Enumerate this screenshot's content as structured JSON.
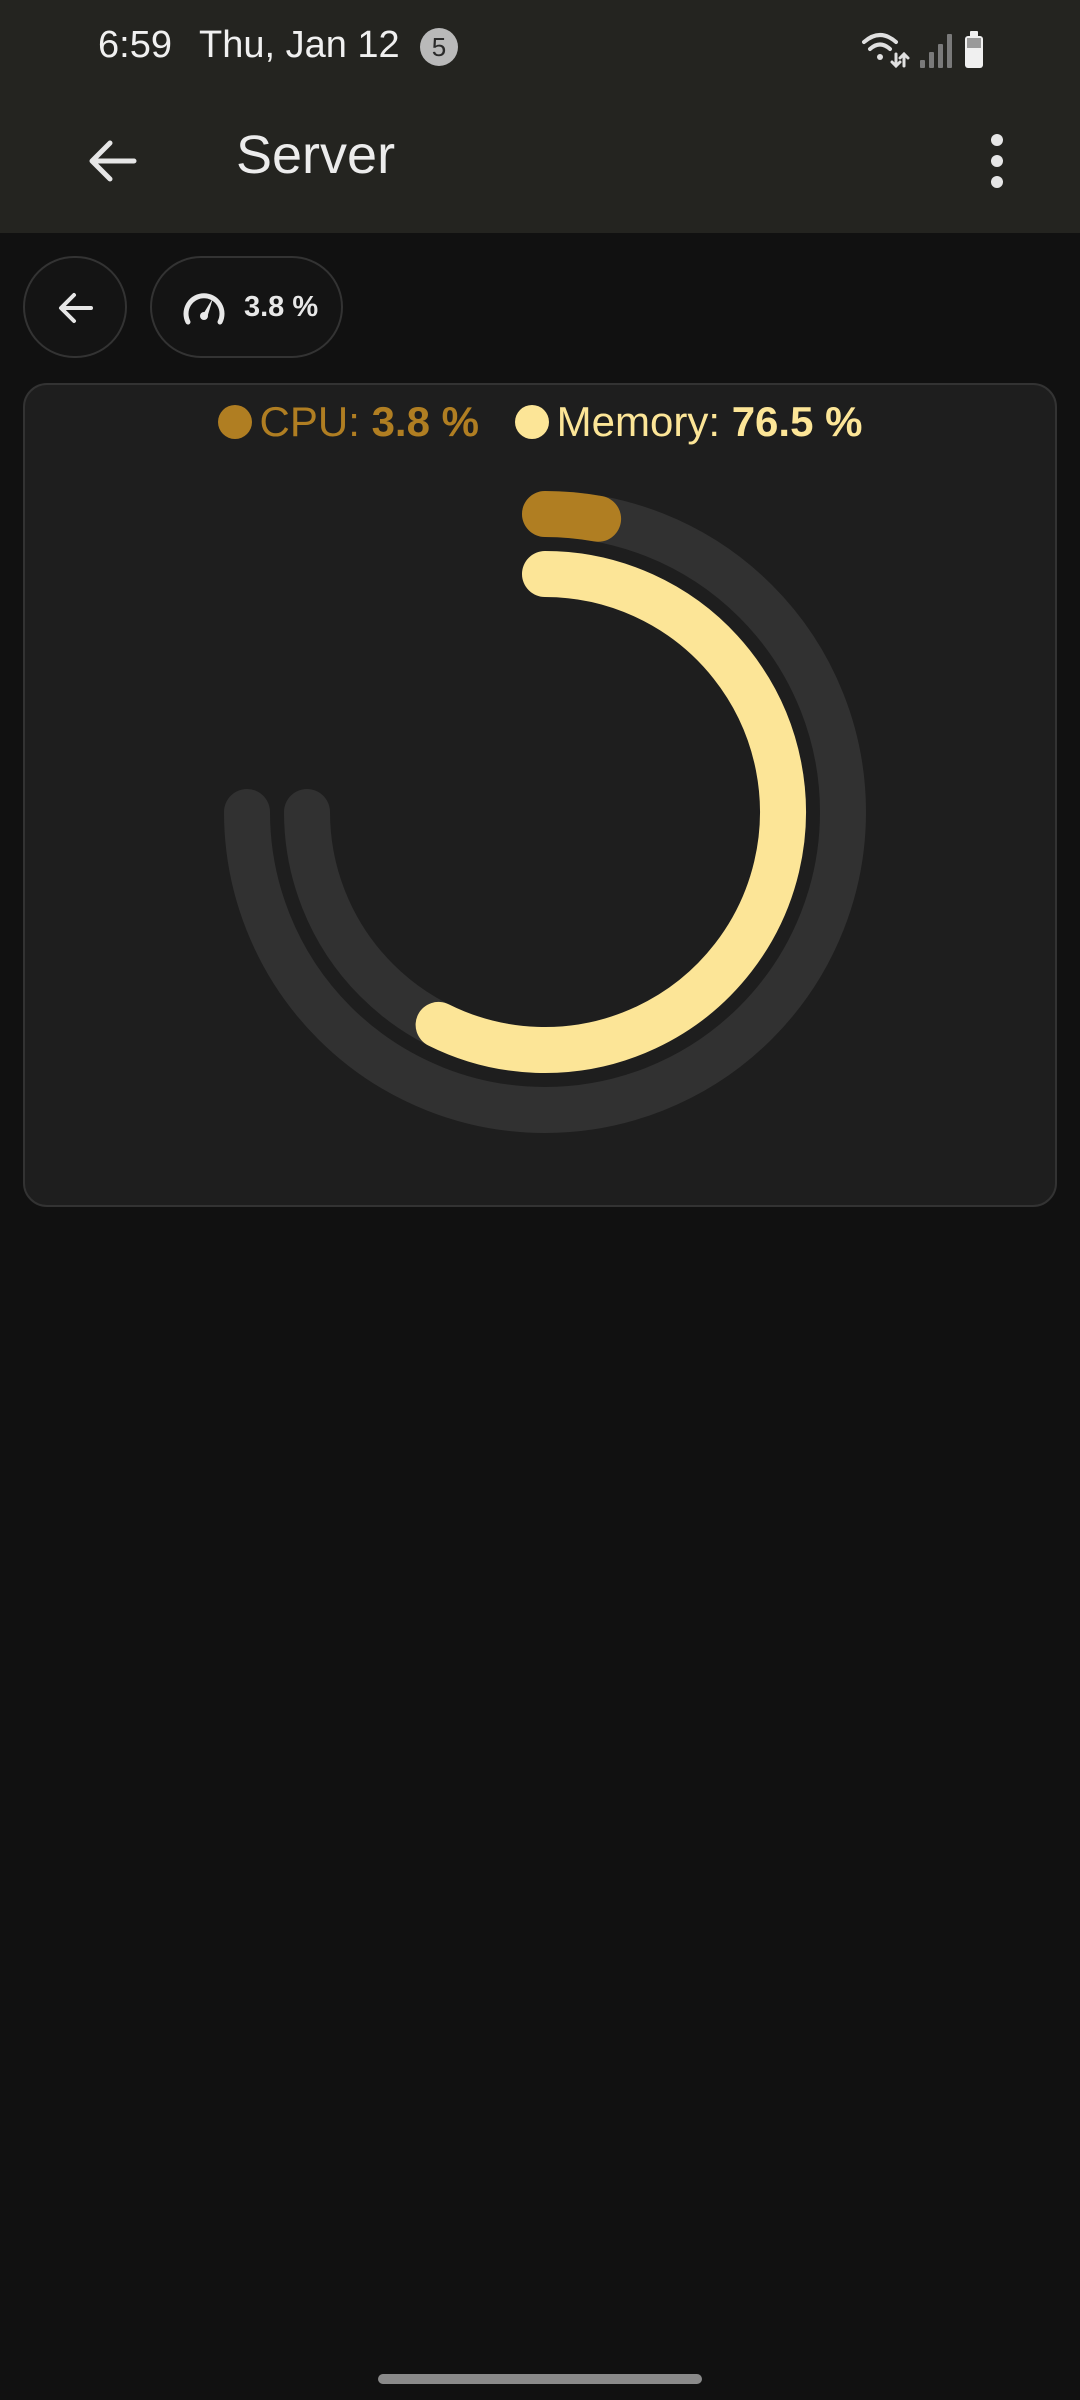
{
  "status_bar": {
    "time": "6:59",
    "date": "Thu, Jan 12",
    "notification_count": "5",
    "icons": [
      "wifi-icon",
      "signal-icon",
      "battery-icon"
    ]
  },
  "app_bar": {
    "title": "Server",
    "icons": [
      "back-arrow-icon",
      "overflow-menu-icon"
    ]
  },
  "chips": {
    "cpu_label": "3.8 %"
  },
  "gauge": {
    "cpu": {
      "label": "CPU:",
      "value_text": "3.8 %",
      "fraction": 0.038,
      "color": "#b07e22"
    },
    "memory": {
      "label": "Memory:",
      "value_text": "76.5 %",
      "fraction": 0.765,
      "color": "#fce597"
    },
    "track_color": "#313131"
  },
  "colors": {
    "background": "#111111",
    "bar_background": "#242420",
    "card_background": "#1e1e1e"
  }
}
